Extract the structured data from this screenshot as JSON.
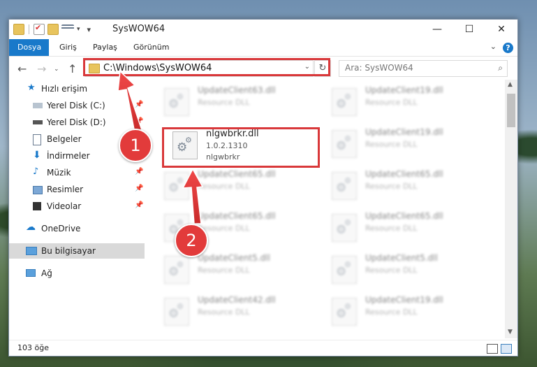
{
  "window": {
    "title": "SysWOW64"
  },
  "ribbon": {
    "tabs": [
      "Dosya",
      "Giriş",
      "Paylaş",
      "Görünüm"
    ]
  },
  "address": {
    "path": "C:\\Windows\\SysWOW64"
  },
  "search": {
    "placeholder": "Ara: SysWOW64"
  },
  "sidebar": {
    "items": [
      {
        "label": "Hızlı erişim",
        "icon": "star-icon"
      },
      {
        "label": "Yerel Disk (C:)",
        "icon": "drive-icon"
      },
      {
        "label": "Yerel Disk (D:)",
        "icon": "drive-icon"
      },
      {
        "label": "Belgeler",
        "icon": "documents-icon"
      },
      {
        "label": "İndirmeler",
        "icon": "download-icon"
      },
      {
        "label": "Müzik",
        "icon": "music-icon"
      },
      {
        "label": "Resimler",
        "icon": "pictures-icon"
      },
      {
        "label": "Videolar",
        "icon": "videos-icon"
      },
      {
        "label": "OneDrive",
        "icon": "cloud-icon"
      },
      {
        "label": "Bu bilgisayar",
        "icon": "computer-icon"
      },
      {
        "label": "Ağ",
        "icon": "network-icon"
      }
    ]
  },
  "files": [
    {
      "name": "UpdateClient63.dll",
      "desc": "Resource DLL"
    },
    {
      "name": "UpdateClient19.dll",
      "desc": "Resource DLL"
    },
    {
      "name": "UpdateClient19.dll",
      "desc": "Resource DLL"
    },
    {
      "name": "UpdateClient65.dll",
      "desc": "Resource DLL"
    },
    {
      "name": "UpdateClient65.dll",
      "desc": "Resource DLL"
    },
    {
      "name": "UpdateClient65.dll",
      "desc": "Resource DLL"
    },
    {
      "name": "UpdateClient65.dll",
      "desc": "Resource DLL"
    },
    {
      "name": "UpdateClient5.dll",
      "desc": "Resource DLL"
    },
    {
      "name": "UpdateClient5.dll",
      "desc": "Resource DLL"
    },
    {
      "name": "UpdateClient42.dll",
      "desc": "Resource DLL"
    },
    {
      "name": "UpdateClient19.dll",
      "desc": "Resource DLL"
    }
  ],
  "featured_file": {
    "name": "nlgwbrkr.dll",
    "version": "1.0.2.1310",
    "desc": "nlgwbrkr"
  },
  "status": {
    "count": "103 öğe"
  },
  "badges": {
    "one": "1",
    "two": "2"
  },
  "colors": {
    "accent": "#1979ca",
    "highlight": "#d9383a"
  }
}
